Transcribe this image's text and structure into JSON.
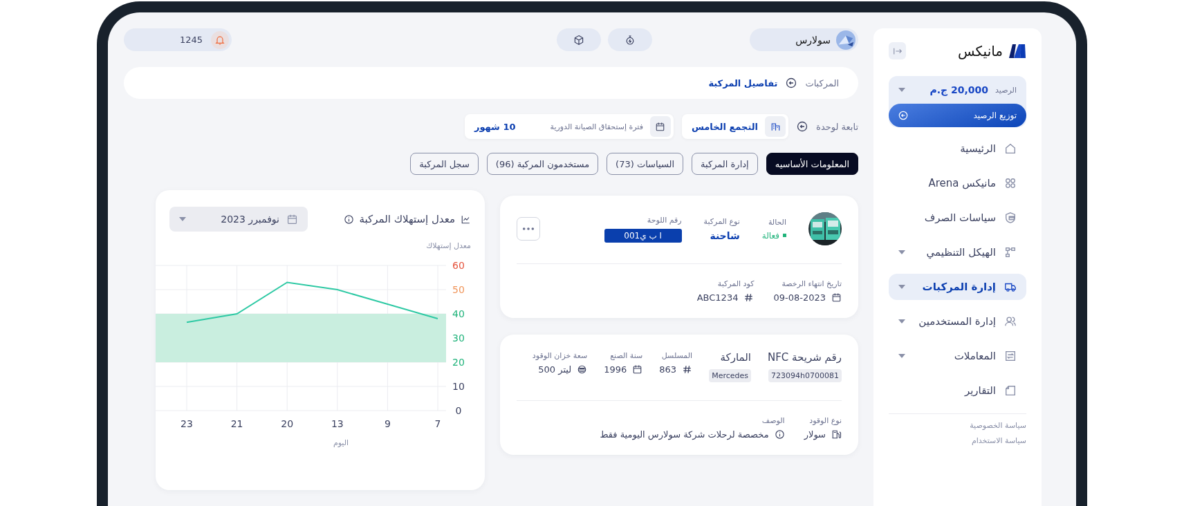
{
  "sidebar": {
    "brand": "مانيكس",
    "balance": {
      "label": "الرصيد",
      "value": "20,000 ج.م",
      "button": "توزيع الرصيد"
    },
    "items": [
      {
        "label": "الرئيسية",
        "selected": false,
        "expandable": false
      },
      {
        "label": "مانيكس Arena",
        "selected": false,
        "expandable": false
      },
      {
        "label": "سياسات الصرف",
        "selected": false,
        "expandable": false
      },
      {
        "label": "الهيكل التنظيمي",
        "selected": false,
        "expandable": true
      },
      {
        "label": "إدارة المركبات",
        "selected": true,
        "expandable": true
      },
      {
        "label": "إدارة المستخدمين",
        "selected": false,
        "expandable": true
      },
      {
        "label": "المعاملات",
        "selected": false,
        "expandable": true
      },
      {
        "label": "التقارير",
        "selected": false,
        "expandable": false
      }
    ],
    "footer_links": [
      "سياسة الخصوصية",
      "سياسة الاستخدام"
    ]
  },
  "topbar": {
    "company": "سولارس",
    "notifications": "1245"
  },
  "breadcrumb": [
    {
      "label": "المركبات",
      "selected": false
    },
    {
      "label": "تفاصيل المركبة",
      "selected": true
    }
  ],
  "unit": {
    "label": "تابعة لوحدة",
    "value": "التجمع الخامس"
  },
  "maintenance": {
    "label": "فترة إستحقاق الصيانة الدورية",
    "value": "10 شهور"
  },
  "tabs": [
    {
      "label": "المعلومات الأساسيه",
      "selected": true
    },
    {
      "label": "إدارة المركبة",
      "selected": false
    },
    {
      "label": "السياسات (73)",
      "selected": false
    },
    {
      "label": "مستخدمون المركبة (96)",
      "selected": false
    },
    {
      "label": "سجل المركبة",
      "selected": false
    }
  ],
  "vehicle": {
    "status_label": "الحالة",
    "status": "فعالة",
    "active": true,
    "type_label": "نوع المركبة",
    "type": "شاحنة",
    "plate_label": "رقم اللوحة",
    "plate": "ا ب ي001",
    "license_label": "تاريخ انتهاء الرخصة",
    "license": "09-08-2023",
    "code_label": "كود المركبة",
    "code": "ABC1234"
  },
  "specs": [
    {
      "kind": "chip",
      "label": "رقم شريحة NFC",
      "value": "723094h0700081"
    },
    {
      "kind": "chip",
      "label": "الماركة",
      "value": "Mercedes"
    },
    {
      "kind": "stat",
      "label": "المسلسل",
      "value": "863"
    },
    {
      "kind": "stat",
      "label": "سنة الصنع",
      "value": "1996"
    },
    {
      "kind": "stat",
      "label": "سعة خزان الوقود",
      "value": "ليتر 500"
    }
  ],
  "fuel": {
    "label": "نوع الوقود",
    "value": "سولار"
  },
  "description": {
    "label": "الوصف",
    "value": "مخصصة لرحلات شركة سولارس اليومية فقط"
  },
  "consumption": {
    "title": "معدل إستهلاك المركبة",
    "month": "نوفمبرر 2023",
    "chart_data": {
      "type": "line",
      "xlabel": "اليوم",
      "ylabel": "معدل إستهلاك",
      "categories": [
        "23",
        "21",
        "20",
        "13",
        "9",
        "7"
      ],
      "series": [
        {
          "color": "#2ec9a4",
          "values": [
            36.5,
            40,
            53,
            50,
            44,
            38
          ]
        }
      ],
      "ylim": [
        0,
        60
      ],
      "yticks": [
        0,
        10,
        20,
        30,
        40,
        50,
        60
      ],
      "grid": true,
      "bands": [
        {
          "axis": "y",
          "from": 20,
          "to": 40,
          "color": "#c9eedf"
        }
      ]
    }
  }
}
